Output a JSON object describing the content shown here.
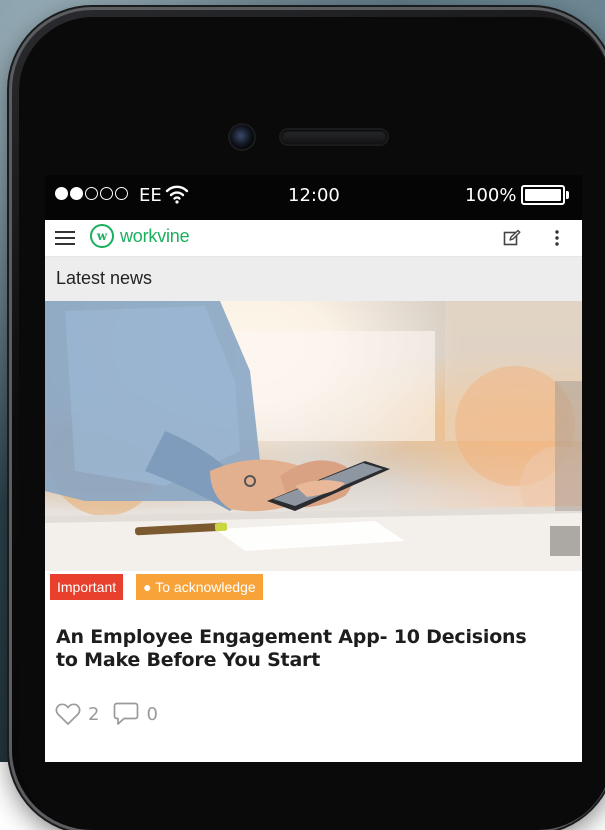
{
  "status_bar": {
    "carrier": "EE",
    "time": "12:00",
    "battery": "100%",
    "signal_bars_filled": 2,
    "signal_bars_total": 5
  },
  "app_bar": {
    "logo_text": "workvine",
    "logo_mark": "w"
  },
  "section": {
    "title": "Latest news"
  },
  "article": {
    "tags": [
      {
        "label": "Important"
      },
      {
        "label": "To acknowledge",
        "bullet": "●"
      }
    ],
    "title_line1": "An Employee Engagement App- 10 Decisions",
    "title_line2": "to Make Before You Start",
    "likes": "2",
    "comments": "0"
  },
  "colors": {
    "brand": "#1aaf5d",
    "important": "#e8402c",
    "acknowledge": "#f7a33a"
  }
}
